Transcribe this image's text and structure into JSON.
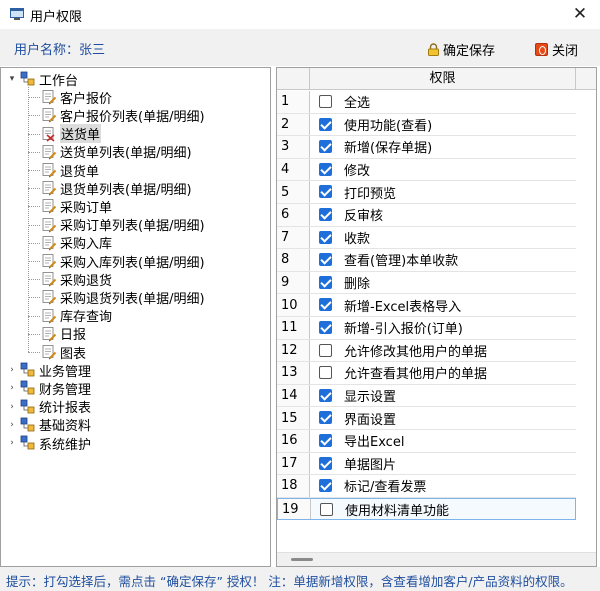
{
  "window": {
    "title": "用户权限",
    "close_glyph": "✕"
  },
  "header": {
    "user_label": "用户名称：",
    "user_name": "张三",
    "save_label": "确定保存",
    "close_label": "关闭"
  },
  "tree": {
    "root": {
      "label": "工作台",
      "icon": "folder-tree-icon"
    },
    "items": [
      {
        "label": "客户报价",
        "icon": "document-pencil-icon"
      },
      {
        "label": "客户报价列表(单据/明细)",
        "icon": "document-pencil-icon"
      },
      {
        "label": "送货单",
        "icon": "document-delivery-icon"
      },
      {
        "label": "送货单列表(单据/明细)",
        "icon": "document-pencil-icon"
      },
      {
        "label": "退货单",
        "icon": "document-pencil-icon"
      },
      {
        "label": "退货单列表(单据/明细)",
        "icon": "document-pencil-icon"
      },
      {
        "label": "采购订单",
        "icon": "document-pencil-icon"
      },
      {
        "label": "采购订单列表(单据/明细)",
        "icon": "document-pencil-icon"
      },
      {
        "label": "采购入库",
        "icon": "document-pencil-icon"
      },
      {
        "label": "采购入库列表(单据/明细)",
        "icon": "document-pencil-icon"
      },
      {
        "label": "采购退货",
        "icon": "document-pencil-icon"
      },
      {
        "label": "采购退货列表(单据/明细)",
        "icon": "document-pencil-icon"
      },
      {
        "label": "库存查询",
        "icon": "document-pencil-icon"
      },
      {
        "label": "日报",
        "icon": "document-pencil-icon"
      },
      {
        "label": "图表",
        "icon": "document-pencil-icon"
      }
    ],
    "groups": [
      {
        "label": "业务管理",
        "icon": "folder-tree-icon"
      },
      {
        "label": "财务管理",
        "icon": "folder-tree-icon"
      },
      {
        "label": "统计报表",
        "icon": "folder-tree-icon"
      },
      {
        "label": "基础资料",
        "icon": "folder-tree-icon"
      },
      {
        "label": "系统维护",
        "icon": "folder-tree-icon"
      }
    ],
    "selected_item": "送货单"
  },
  "grid": {
    "column_title": "权限",
    "rows": [
      {
        "num": "1",
        "label": "全选",
        "checked": false
      },
      {
        "num": "2",
        "label": "使用功能(查看)",
        "checked": true
      },
      {
        "num": "3",
        "label": "新增(保存单据)",
        "checked": true
      },
      {
        "num": "4",
        "label": "修改",
        "checked": true
      },
      {
        "num": "5",
        "label": "打印预览",
        "checked": true
      },
      {
        "num": "6",
        "label": "反审核",
        "checked": true
      },
      {
        "num": "7",
        "label": "收款",
        "checked": true
      },
      {
        "num": "8",
        "label": "查看(管理)本单收款",
        "checked": true
      },
      {
        "num": "9",
        "label": "删除",
        "checked": true
      },
      {
        "num": "10",
        "label": "新增-Excel表格导入",
        "checked": true
      },
      {
        "num": "11",
        "label": "新增-引入报价(订单)",
        "checked": true
      },
      {
        "num": "12",
        "label": "允许修改其他用户的单据",
        "checked": false
      },
      {
        "num": "13",
        "label": "允许查看其他用户的单据",
        "checked": false
      },
      {
        "num": "14",
        "label": "显示设置",
        "checked": true
      },
      {
        "num": "15",
        "label": "界面设置",
        "checked": true
      },
      {
        "num": "16",
        "label": "导出Excel",
        "checked": true
      },
      {
        "num": "17",
        "label": "单据图片",
        "checked": true
      },
      {
        "num": "18",
        "label": "标记/查看发票",
        "checked": true
      },
      {
        "num": "19",
        "label": "使用材料清单功能",
        "checked": false
      }
    ]
  },
  "status": {
    "tip": "提示：打勾选择后，需点击 “确定保存” 授权！ 注：单据新增权限，含查看增加客户/产品资料的权限。"
  },
  "colors": {
    "accent_blue": "#1f4e9e",
    "checkbox_checked": "#1e6fd9",
    "close_icon_red": "#e64a19"
  }
}
